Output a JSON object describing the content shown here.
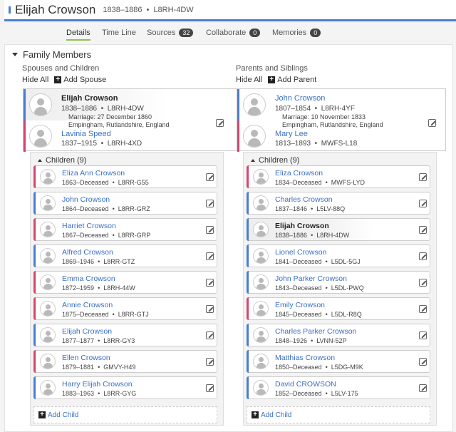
{
  "person": {
    "name": "Elijah Crowson",
    "lifespan": "1838–1886",
    "id": "L8RH-4DW",
    "color": "#4a7cd6"
  },
  "tabs": [
    {
      "label": "Details",
      "active": true
    },
    {
      "label": "Time Line"
    },
    {
      "label": "Sources",
      "count": "32"
    },
    {
      "label": "Collaborate",
      "count": "0"
    },
    {
      "label": "Memories",
      "count": "0"
    }
  ],
  "section": {
    "title": "Family Members"
  },
  "spouses": {
    "heading": "Spouses and Children",
    "hide_all": "Hide All",
    "add": "Add Spouse",
    "husband": {
      "name": "Elijah Crowson",
      "lifespan": "1838–1886",
      "id": "L8RH-4DW"
    },
    "marriage": {
      "date": "Marriage: 27 December 1860",
      "place": "Empingham, Rutlandshire, England"
    },
    "wife": {
      "name": "Lavinia Speed",
      "lifespan": "1837–1915",
      "id": "L8RH-4XD"
    },
    "children_title": "Children (9)",
    "add_child": "Add Child",
    "children": [
      {
        "name": "Eliza Ann Crowson",
        "lifespan": "1863–Deceased",
        "id": "L8RR-G55",
        "sex": "female"
      },
      {
        "name": "John Crowson",
        "lifespan": "1864–Deceased",
        "id": "L8RR-GRZ",
        "sex": "male"
      },
      {
        "name": "Harriet Crowson",
        "lifespan": "1867–Deceased",
        "id": "L8RR-GRP",
        "sex": "female"
      },
      {
        "name": "Alfred Crowson",
        "lifespan": "1869–1946",
        "id": "L8RR-GTZ",
        "sex": "male"
      },
      {
        "name": "Emma Crowson",
        "lifespan": "1872–1959",
        "id": "L8RH-44W",
        "sex": "female"
      },
      {
        "name": "Annie Crowson",
        "lifespan": "1875–Deceased",
        "id": "L8RR-GTJ",
        "sex": "female"
      },
      {
        "name": "Elijah Crowson",
        "lifespan": "1877–1877",
        "id": "L8RR-GY3",
        "sex": "male"
      },
      {
        "name": "Ellen Crowson",
        "lifespan": "1879–1881",
        "id": "GMVY-H49",
        "sex": "female"
      },
      {
        "name": "Harry Elijah Crowson",
        "lifespan": "1883–1963",
        "id": "L8RR-GYG",
        "sex": "male"
      }
    ]
  },
  "parents": {
    "heading": "Parents and Siblings",
    "hide_all": "Hide All",
    "add": "Add Parent",
    "father": {
      "name": "John Crowson",
      "lifespan": "1807–1854",
      "id": "L8RH-4YF"
    },
    "marriage": {
      "date": "Marriage: 10 November 1833",
      "place": "Empingham, Rutlandshire, England"
    },
    "mother": {
      "name": "Mary Lee",
      "lifespan": "1813–1893",
      "id": "MWFS-L18"
    },
    "children_title": "Children (9)",
    "add_child": "Add Child",
    "children": [
      {
        "name": "Eliza Crowson",
        "lifespan": "1834–Deceased",
        "id": "MWFS-LYD",
        "sex": "female"
      },
      {
        "name": "Charles Crowson",
        "lifespan": "1837–1846",
        "id": "L5LV-88Q",
        "sex": "male"
      },
      {
        "name": "Elijah Crowson",
        "lifespan": "1838–1886",
        "id": "L8RH-4DW",
        "sex": "male",
        "current": true
      },
      {
        "name": "Lionel Crowson",
        "lifespan": "1841–Deceased",
        "id": "L5DL-5GJ",
        "sex": "male"
      },
      {
        "name": "John Parker Crowson",
        "lifespan": "1843–Deceased",
        "id": "L5DL-PWQ",
        "sex": "male"
      },
      {
        "name": "Emily Crowson",
        "lifespan": "1845–Deceased",
        "id": "L5DL-R8Q",
        "sex": "female"
      },
      {
        "name": "Charles Parker Crowson",
        "lifespan": "1848–1926",
        "id": "LVNN-52P",
        "sex": "male"
      },
      {
        "name": "Matthias Crowson",
        "lifespan": "1850–Deceased",
        "id": "L5DG-M9K",
        "sex": "male"
      },
      {
        "name": "David CROWSON",
        "lifespan": "1852–Deceased",
        "id": "L5LV-175",
        "sex": "male"
      }
    ]
  },
  "colors": {
    "male": "#4a7cd6",
    "female": "#d6456e",
    "link": "#3b6fc4",
    "tab_underline": "#8bc34a"
  }
}
